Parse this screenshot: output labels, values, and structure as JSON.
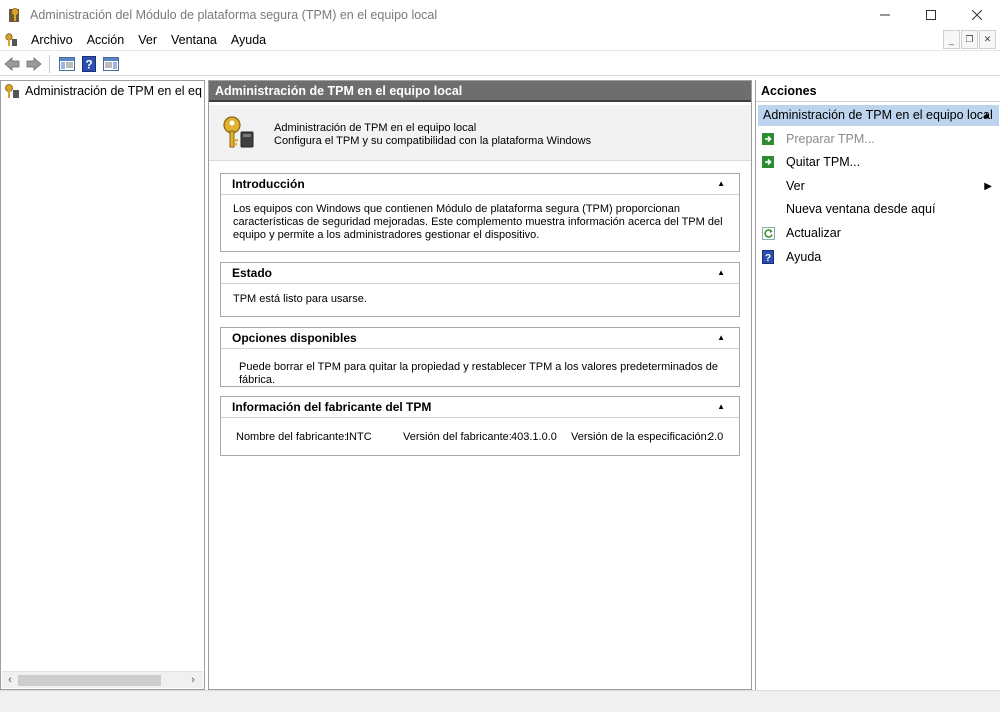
{
  "window": {
    "title": "Administración del Módulo de plataforma segura (TPM) en el equipo local",
    "minimize_icon": "minimize-icon",
    "maximize_icon": "maximize-icon",
    "close_icon": "close-icon"
  },
  "menubar": {
    "items": [
      "Archivo",
      "Acción",
      "Ver",
      "Ventana",
      "Ayuda"
    ]
  },
  "toolbar": {
    "icons": [
      "back-arrow-icon",
      "forward-arrow-icon",
      "show-hide-tree-icon",
      "help-icon",
      "show-hide-action-pane-icon"
    ]
  },
  "tree": {
    "root_label": "Administración de TPM en el equipo local"
  },
  "center": {
    "header": "Administración de TPM en el equipo local",
    "intro_title": "Administración de TPM en el equipo local",
    "intro_subtitle": "Configura el TPM y su compatibilidad con la plataforma Windows",
    "sections": {
      "introduccion": {
        "title": "Introducción",
        "body": "Los equipos con Windows que contienen Módulo de plataforma segura (TPM) proporcionan características de seguridad mejoradas. Este complemento muestra información acerca del TPM del equipo y permite a los administradores gestionar el dispositivo."
      },
      "estado": {
        "title": "Estado",
        "body": "TPM está listo para usarse."
      },
      "opciones": {
        "title": "Opciones disponibles",
        "body": "Puede borrar el TPM para quitar la propiedad y restablecer TPM a los valores predeterminados de fábrica."
      },
      "fabricante": {
        "title": "Información del fabricante del TPM",
        "name_label": "Nombre del fabricante:",
        "name_value": "INTC",
        "version_label": "Versión del fabricante:",
        "version_value": "403.1.0.0",
        "spec_label": "Versión de la especificación:",
        "spec_value": "2.0"
      }
    }
  },
  "actions": {
    "header": "Acciones",
    "selected": "Administración de TPM en el equipo local",
    "items": {
      "preparar": "Preparar TPM...",
      "quitar": "Quitar TPM...",
      "ver": "Ver",
      "nueva_ventana": "Nueva ventana desde aquí",
      "actualizar": "Actualizar",
      "ayuda": "Ayuda"
    }
  },
  "colors": {
    "header_gray": "#6e6e6e",
    "selected_blue": "#bcd4ee",
    "action_green": "#2e8b2e",
    "help_blue": "#2b4eb0"
  }
}
